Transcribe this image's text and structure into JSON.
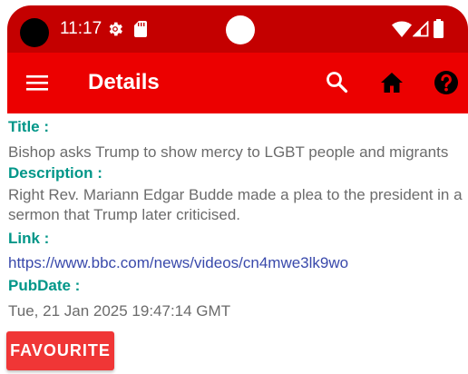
{
  "status_bar": {
    "time": "11:17",
    "icons": [
      "settings-gear-icon",
      "sd-card-icon",
      "notification-dot",
      "wifi-icon",
      "cell-signal-icon",
      "battery-icon"
    ]
  },
  "app_bar": {
    "title": "Details",
    "icons": [
      "menu-icon",
      "search-icon",
      "home-icon",
      "help-icon"
    ],
    "color": "#ec0000"
  },
  "details": {
    "title_label": "Title :",
    "title_value": "Bishop asks Trump to show mercy to LGBT people and migrants",
    "description_label": "Description :",
    "description_value": "Right Rev. Mariann Edgar Budde made a plea to the president in a sermon that Trump later criticised.",
    "link_label": "Link :",
    "link_value": "https://www.bbc.com/news/videos/cn4mwe3lk9wo",
    "pubdate_label": "PubDate :",
    "pubdate_value": "Tue, 21 Jan 2025 19:47:14 GMT"
  },
  "actions": {
    "favourite_label": "FAVOURITE"
  },
  "colors": {
    "label": "#009688",
    "value": "#6b6b6b",
    "link": "#3949ab",
    "button": "#f03636"
  }
}
